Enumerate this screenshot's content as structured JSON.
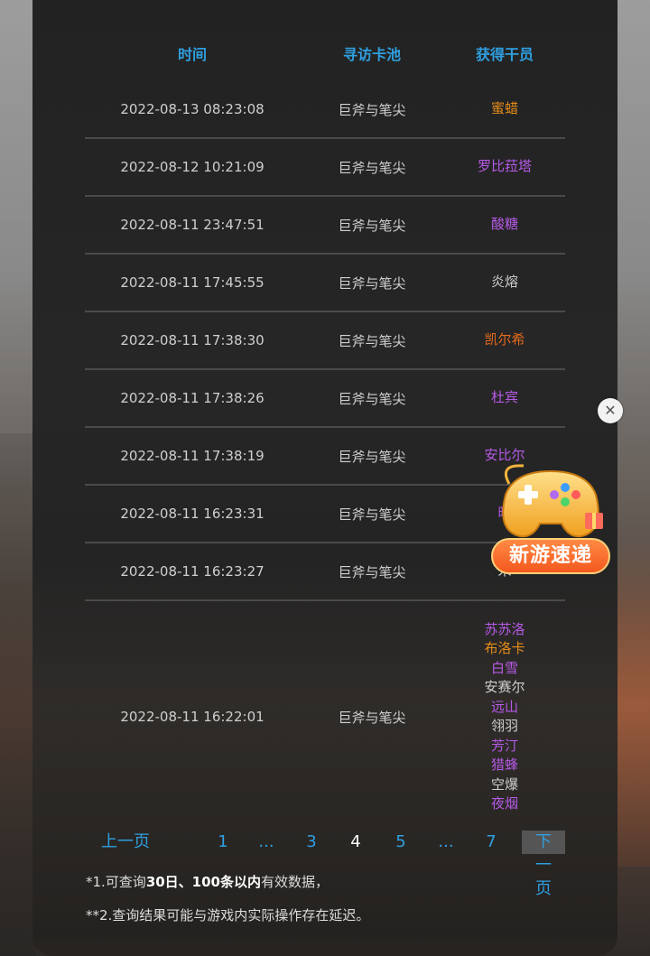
{
  "table": {
    "headers": [
      "时间",
      "寻访卡池",
      "获得干员"
    ],
    "rows": [
      {
        "time": "2022-08-13 08:23:08",
        "pool": "巨斧与笔尖",
        "operators": [
          {
            "name": "蜜蜡",
            "color": "#e58c1a"
          }
        ]
      },
      {
        "time": "2022-08-12 10:21:09",
        "pool": "巨斧与笔尖",
        "operators": [
          {
            "name": "罗比菈塔",
            "color": "#b65ae6"
          }
        ]
      },
      {
        "time": "2022-08-11 23:47:51",
        "pool": "巨斧与笔尖",
        "operators": [
          {
            "name": "酸糖",
            "color": "#b65ae6"
          }
        ]
      },
      {
        "time": "2022-08-11 17:45:55",
        "pool": "巨斧与笔尖",
        "operators": [
          {
            "name": "炎熔",
            "color": "#cfcfcf"
          }
        ]
      },
      {
        "time": "2022-08-11 17:38:30",
        "pool": "巨斧与笔尖",
        "operators": [
          {
            "name": "凯尔希",
            "color": "#e36a1c"
          }
        ]
      },
      {
        "time": "2022-08-11 17:38:26",
        "pool": "巨斧与笔尖",
        "operators": [
          {
            "name": "杜宾",
            "color": "#b65ae6"
          }
        ]
      },
      {
        "time": "2022-08-11 17:38:19",
        "pool": "巨斧与笔尖",
        "operators": [
          {
            "name": "安比尔",
            "color": "#b65ae6"
          }
        ]
      },
      {
        "time": "2022-08-11 16:23:31",
        "pool": "巨斧与笔尖",
        "operators": [
          {
            "name": "暗",
            "color": "#b65ae6"
          }
        ]
      },
      {
        "time": "2022-08-11 16:23:27",
        "pool": "巨斧与笔尖",
        "operators": [
          {
            "name": "米",
            "color": "#cfcfcf"
          }
        ]
      },
      {
        "time": "2022-08-11 16:22:01",
        "pool": "巨斧与笔尖",
        "operators": [
          {
            "name": "苏苏洛",
            "color": "#b65ae6"
          },
          {
            "name": "布洛卡",
            "color": "#e58c1a"
          },
          {
            "name": "白雪",
            "color": "#b65ae6"
          },
          {
            "name": "安赛尔",
            "color": "#cfcfcf"
          },
          {
            "name": "远山",
            "color": "#b65ae6"
          },
          {
            "name": "翎羽",
            "color": "#cfcfcf"
          },
          {
            "name": "芳汀",
            "color": "#b65ae6"
          },
          {
            "name": "猎蜂",
            "color": "#b65ae6"
          },
          {
            "name": "空爆",
            "color": "#cfcfcf"
          },
          {
            "name": "夜烟",
            "color": "#b65ae6"
          }
        ]
      }
    ]
  },
  "pagination": {
    "prev_label": "上一页",
    "pages": [
      "1",
      "...",
      "3",
      "4",
      "5",
      "...",
      "7"
    ],
    "current": "4",
    "next_label": "下一页"
  },
  "notes": {
    "note1_prefix": "*1.可查询",
    "note1_bold": "30日、100条以内",
    "note1_suffix": "有效数据，",
    "note2": "**2.查询结果可能与游戏内实际操作存在延迟。"
  },
  "widget": {
    "label": "新游速递",
    "close_symbol": "✕"
  },
  "colors": {
    "accent": "#2f9fe0",
    "six_star": "#e36a1c",
    "five_star": "#e58c1a",
    "four_star": "#b65ae6",
    "three_star": "#cfcfcf"
  }
}
